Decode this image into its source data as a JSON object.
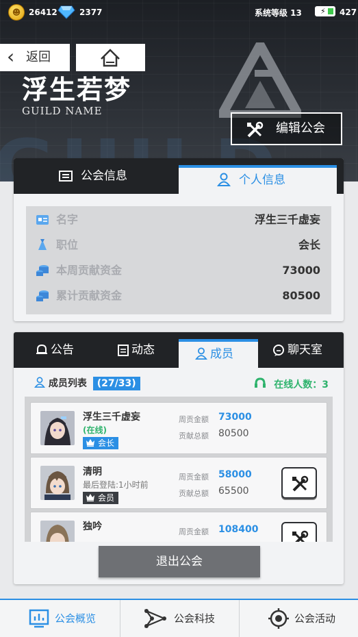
{
  "status": {
    "coins": "26412",
    "gems": "2377",
    "system_level": "系统等级 13",
    "battery": "427"
  },
  "header": {
    "back_label": "返回",
    "guild_name": "浮生若梦",
    "guild_subtitle": "GUILD NAME",
    "edit_label": "编辑公会"
  },
  "info_tabs": [
    {
      "label": "公会信息",
      "active": false
    },
    {
      "label": "个人信息",
      "active": true
    }
  ],
  "personal_info": [
    {
      "label": "名字",
      "value": "浮生三千虚妄",
      "icon": "id-card-icon"
    },
    {
      "label": "职位",
      "value": "会长",
      "icon": "tie-icon"
    },
    {
      "label": "本周贡献资金",
      "value": "73000",
      "icon": "coin-stack-icon"
    },
    {
      "label": "累计贡献资金",
      "value": "80500",
      "icon": "coin-stack-icon"
    }
  ],
  "guild_tabs": [
    {
      "label": "公告",
      "icon": "bell-icon",
      "active": false
    },
    {
      "label": "动态",
      "icon": "clipboard-icon",
      "active": false
    },
    {
      "label": "成员",
      "icon": "person-icon",
      "active": true
    },
    {
      "label": "聊天室",
      "icon": "chat-icon",
      "active": false
    }
  ],
  "members_header": {
    "label": "成员列表",
    "count": "(27/33)",
    "online": "在线人数：3"
  },
  "members": [
    {
      "name": "浮生三千虚妄",
      "status": "(在线)",
      "role": "会长",
      "weekly_label": "周贡金额",
      "weekly": "73000",
      "total_label": "贡献总额",
      "total": "80500"
    },
    {
      "name": "清明",
      "status": "最后登陆:1小时前",
      "role": "会员",
      "weekly_label": "周贡金额",
      "weekly": "58000",
      "total_label": "贡献总额",
      "total": "65500"
    },
    {
      "name": "独吟",
      "weekly_label": "周贡金额",
      "weekly": "108400"
    }
  ],
  "quit_label": "退出公会",
  "bottom_nav": [
    {
      "label": "公会概览",
      "active": true
    },
    {
      "label": "公会科技",
      "active": false
    },
    {
      "label": "公会活动",
      "active": false
    }
  ],
  "colors": {
    "accent": "#2b8fe4",
    "online": "#2fb36d",
    "dark": "#212326"
  }
}
